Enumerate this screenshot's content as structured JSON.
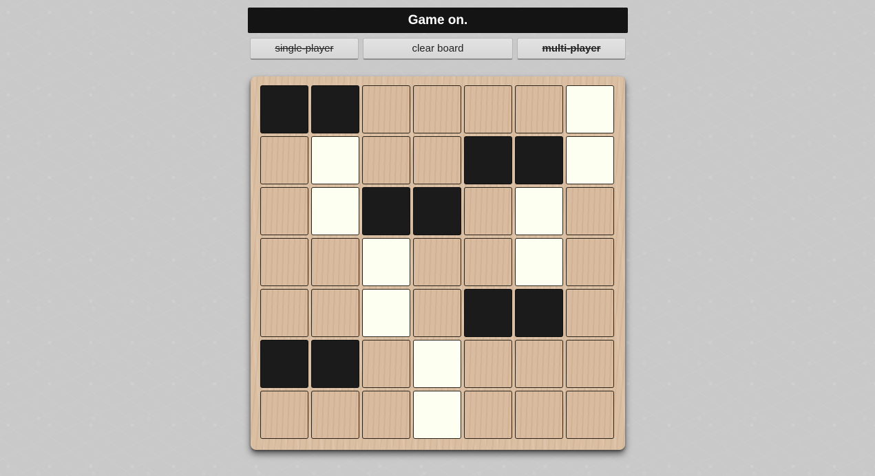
{
  "status": {
    "text": "Game on."
  },
  "buttons": {
    "single_player": "single-player",
    "clear_board": "clear board",
    "multi_player": "multi-player"
  },
  "colors": {
    "black": "#1b1b1b",
    "white": "#fdfff0",
    "empty": "#d9bb9f"
  },
  "board": {
    "rows": 7,
    "cols": 7,
    "cells": [
      [
        "black",
        "black",
        "empty",
        "empty",
        "empty",
        "empty",
        "white"
      ],
      [
        "empty",
        "white",
        "empty",
        "empty",
        "black",
        "black",
        "white"
      ],
      [
        "empty",
        "white",
        "black",
        "black",
        "empty",
        "white",
        "empty"
      ],
      [
        "empty",
        "empty",
        "white",
        "empty",
        "empty",
        "white",
        "empty"
      ],
      [
        "empty",
        "empty",
        "white",
        "empty",
        "black",
        "black",
        "empty"
      ],
      [
        "black",
        "black",
        "empty",
        "white",
        "empty",
        "empty",
        "empty"
      ],
      [
        "empty",
        "empty",
        "empty",
        "white",
        "empty",
        "empty",
        "empty"
      ]
    ]
  }
}
